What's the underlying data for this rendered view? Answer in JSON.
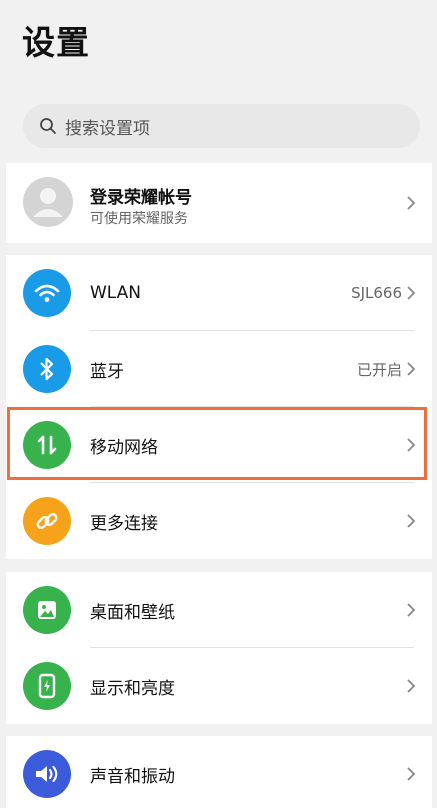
{
  "header": {
    "title": "设置"
  },
  "search": {
    "placeholder": "搜索设置项"
  },
  "account": {
    "title": "登录荣耀帐号",
    "subtitle": "可使用荣耀服务"
  },
  "groups": [
    [
      {
        "label": "WLAN",
        "value": "SJL666",
        "icon": "wifi-icon",
        "color": "#1a9be8"
      },
      {
        "label": "蓝牙",
        "value": "已开启",
        "icon": "bluetooth-icon",
        "color": "#1a9be8"
      },
      {
        "label": "移动网络",
        "value": "",
        "icon": "mobile-data-icon",
        "color": "#37b24d"
      },
      {
        "label": "更多连接",
        "value": "",
        "icon": "link-icon",
        "color": "#f7a21b"
      }
    ],
    [
      {
        "label": "桌面和壁纸",
        "value": "",
        "icon": "wallpaper-icon",
        "color": "#37b24d"
      },
      {
        "label": "显示和亮度",
        "value": "",
        "icon": "display-icon",
        "color": "#37b24d"
      }
    ],
    [
      {
        "label": "声音和振动",
        "value": "",
        "icon": "sound-icon",
        "color": "#3b5bdb"
      }
    ]
  ],
  "highlight_color": "#ee6f3d"
}
